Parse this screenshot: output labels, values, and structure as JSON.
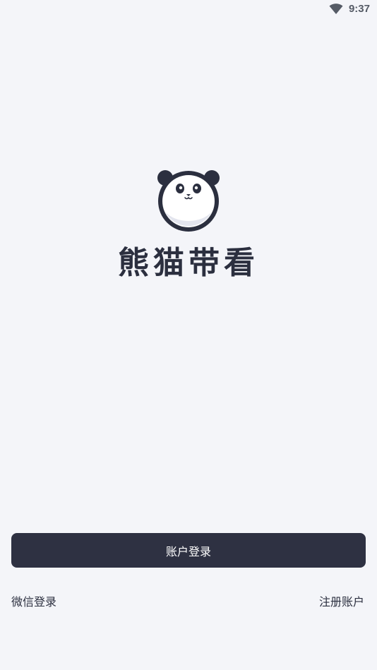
{
  "status_bar": {
    "time": "9:37",
    "icons": [
      "wifi-icon"
    ]
  },
  "brand": {
    "logo": "panda-logo-icon",
    "name": "熊猫带看",
    "colors": {
      "primary": "#2e3142",
      "background": "#f4f5f9",
      "text": "#2b2f3f"
    }
  },
  "actions": {
    "account_login_label": "账户登录",
    "wechat_login_label": "微信登录",
    "register_label": "注册账户"
  }
}
